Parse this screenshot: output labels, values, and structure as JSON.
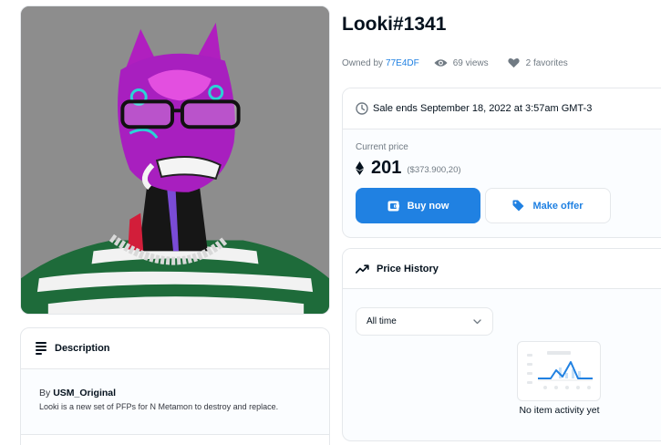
{
  "item": {
    "title": "Looki#1341",
    "owned_by_label": "Owned by",
    "owner": "77E4DF",
    "views": "69 views",
    "favorites": "2 favorites"
  },
  "description": {
    "header": "Description",
    "by_prefix": "By",
    "creator": "USM_Original",
    "text": "Looki is a new set of PFPs for N Metamon to destroy and replace."
  },
  "sale": {
    "ends_text": "Sale ends September 18, 2022 at 3:57am GMT-3",
    "current_price_label": "Current price",
    "price": "201",
    "fiat": "($373.900,20)",
    "buy_label": "Buy now",
    "offer_label": "Make offer"
  },
  "price_history": {
    "header": "Price History",
    "range_selected": "All time",
    "empty_text": "No item activity yet"
  },
  "colors": {
    "accent": "#2081e2",
    "text": "#04111d",
    "muted": "#707a83",
    "border": "#e5e8eb"
  },
  "icons": [
    "wallet-icon",
    "tag-icon",
    "clock-icon",
    "eye-icon",
    "heart-icon",
    "ethereum-icon",
    "trending-icon",
    "chevron-down-icon",
    "description-icon"
  ]
}
